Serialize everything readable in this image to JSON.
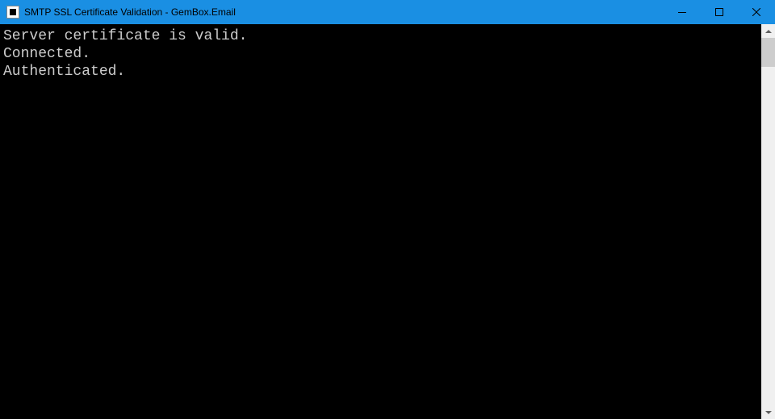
{
  "window": {
    "title": "SMTP SSL Certificate Validation - GemBox.Email"
  },
  "console": {
    "lines": [
      "Server certificate is valid.",
      "Connected.",
      "Authenticated."
    ]
  }
}
